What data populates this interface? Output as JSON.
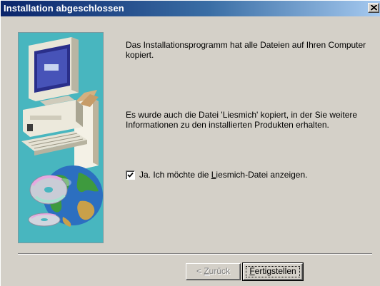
{
  "window": {
    "title": "Installation abgeschlossen"
  },
  "content": {
    "paragraph1": "Das Installationsprogramm hat alle Dateien auf Ihren Computer kopiert.",
    "paragraph2": "Es wurde auch die Datei 'Liesmich' kopiert, in der Sie weitere Informationen zu den installierten Produkten erhalten."
  },
  "checkbox": {
    "label_before": "Ja. Ich möchte die ",
    "label_mnemonic": "L",
    "label_after": "iesmich-Datei anzeigen.",
    "checked": true
  },
  "buttons": {
    "back_prefix": "< ",
    "back_mnemonic": "Z",
    "back_rest": "urück",
    "finish_mnemonic": "F",
    "finish_rest": "ertigstellen"
  },
  "colors": {
    "titlebar_start": "#0a246a",
    "titlebar_end": "#a6caf0",
    "dialog_face": "#d4d0c8",
    "illustration_bg": "#48b6bf"
  },
  "icons": {
    "close": "close-icon",
    "illustration": "computer-with-cd-and-globe-illustration"
  }
}
